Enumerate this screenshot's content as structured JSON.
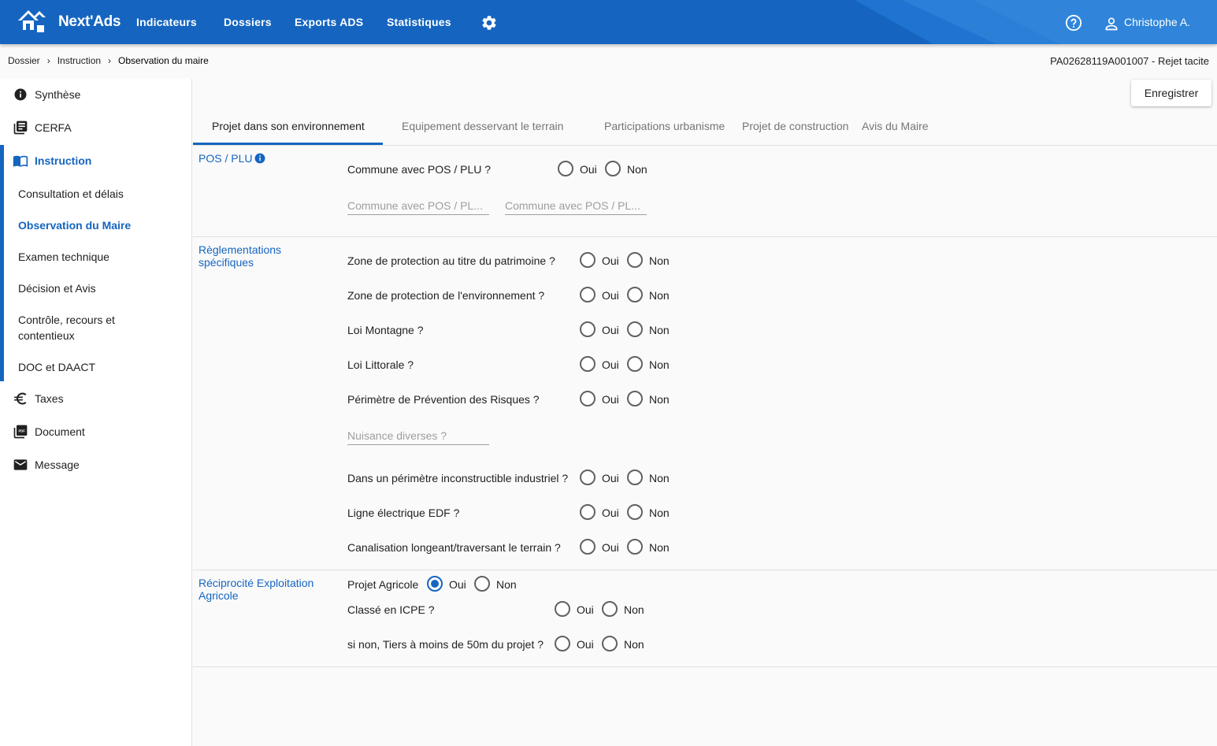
{
  "header": {
    "app_name": "Next'Ads",
    "nav": [
      "Indicateurs",
      "Dossiers",
      "Exports ADS",
      "Statistiques"
    ],
    "user": "Christophe A."
  },
  "breadcrumb": [
    "Dossier",
    "Instruction",
    "Observation du maire"
  ],
  "dossier_ref": "PA02628119A001007 - Rejet tacite",
  "sidebar": {
    "items": [
      "Synthèse",
      "CERFA",
      "Instruction",
      "Taxes",
      "Document",
      "Message"
    ],
    "sub_items": [
      "Consultation et délais",
      "Observation du Maire",
      "Examen technique",
      "Décision et Avis",
      "Contrôle, recours et contentieux",
      "DOC et DAACT"
    ]
  },
  "save_label": "Enregistrer",
  "tabs": [
    "Projet dans son environnement",
    "Equipement desservant le terrain",
    "Participations urbanisme",
    "Projet de construction",
    "Avis du Maire"
  ],
  "radio_labels": {
    "yes": "Oui",
    "no": "Non"
  },
  "sections": {
    "pos": {
      "title": "POS / PLU",
      "question": "Commune avec POS / PLU ?",
      "field1_placeholder": "Commune avec POS / PL...",
      "field2_placeholder": "Commune avec POS / PL..."
    },
    "reglementations": {
      "title": "Règlementations spécifiques",
      "questions": [
        "Zone de protection au titre du patrimoine ?",
        "Zone de protection de l'environnement ?",
        "Loi Montagne ?",
        "Loi Littorale ?",
        "Périmètre de Prévention des Risques ?"
      ],
      "nuisance_placeholder": "Nuisance diverses ?",
      "questions2": [
        "Dans un périmètre inconstructible industriel ?",
        "Ligne électrique EDF ?",
        "Canalisation longeant/traversant le terrain ?"
      ]
    },
    "reciprocite": {
      "title": "Réciprocité Exploitation Agricole",
      "projet_agricole": "Projet Agricole",
      "projet_agricole_value": "Oui",
      "icpe": "Classé en ICPE ?",
      "tiers": "si non, Tiers à moins de 50m du projet ?"
    }
  }
}
